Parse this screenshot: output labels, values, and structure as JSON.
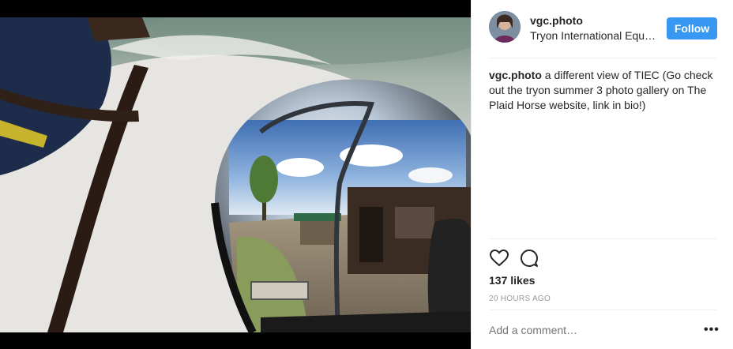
{
  "post": {
    "username": "vgc.photo",
    "location": "Tryon International Equestrian Center",
    "follow_label": "Follow",
    "caption_user": "vgc.photo",
    "caption_text": " a different view of TIEC (Go check out the tryon summer 3 photo gallery on The Plaid Horse website, link in bio!)",
    "likes": "137 likes",
    "timestamp": "20 HOURS AGO",
    "comment_placeholder": "Add a comment…",
    "more_label": "•••"
  },
  "icons": [
    "heart-icon",
    "comment-icon",
    "more-options-icon"
  ],
  "colors": {
    "follow_button": "#3897f0",
    "muted_text": "#999999",
    "divider": "#efefef"
  }
}
